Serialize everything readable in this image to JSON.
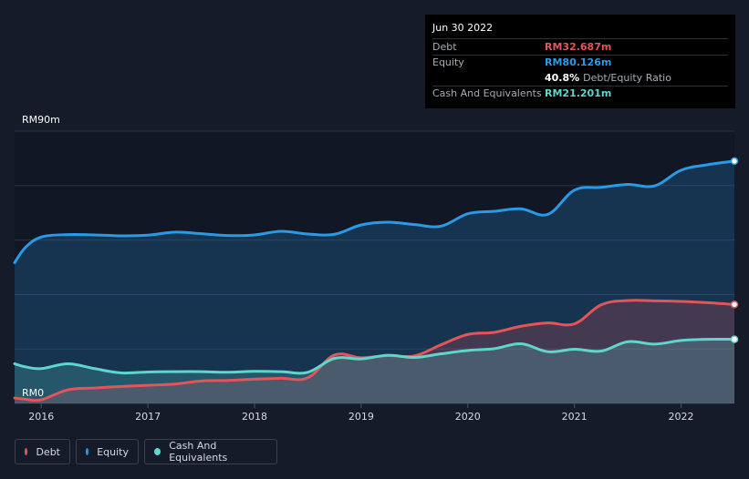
{
  "tooltip": {
    "date": "Jun 30 2022",
    "rows": [
      {
        "label": "Debt",
        "value": "RM32.687m",
        "color": "#e4545a"
      },
      {
        "label": "Equity",
        "value": "RM80.126m",
        "color": "#2a9ae6"
      },
      {
        "label": "",
        "value": "40.8%",
        "sub": "Debt/Equity Ratio",
        "color": "#ffffff"
      },
      {
        "label": "Cash And Equivalents",
        "value": "RM21.201m",
        "color": "#5fd6cc"
      }
    ]
  },
  "legend": [
    {
      "label": "Debt",
      "color": "#e4545a"
    },
    {
      "label": "Equity",
      "color": "#2a9ae6"
    },
    {
      "label": "Cash And Equivalents",
      "color": "#5fd6cc"
    }
  ],
  "chart_data": {
    "type": "area",
    "ylim": [
      0,
      90
    ],
    "y_tick_labels": [
      "RM90m",
      "RM0"
    ],
    "x_tick_labels": [
      "2016",
      "2017",
      "2018",
      "2019",
      "2020",
      "2021",
      "2022"
    ],
    "grid": true,
    "series": [
      {
        "name": "Equity",
        "color": "#2a9ae6",
        "x": [
          2015.75,
          2015.85,
          2016.0,
          2016.25,
          2016.5,
          2016.75,
          2017.0,
          2017.25,
          2017.5,
          2017.75,
          2018.0,
          2018.25,
          2018.5,
          2018.75,
          2019.0,
          2019.25,
          2019.5,
          2019.75,
          2020.0,
          2020.25,
          2020.5,
          2020.75,
          2021.0,
          2021.25,
          2021.5,
          2021.75,
          2022.0,
          2022.25,
          2022.5
        ],
        "values": [
          46.5,
          51.5,
          55.0,
          55.8,
          55.7,
          55.4,
          55.6,
          56.6,
          56.1,
          55.5,
          55.7,
          56.9,
          56.0,
          55.9,
          59.0,
          59.9,
          59.1,
          58.6,
          62.7,
          63.5,
          64.3,
          62.5,
          70.5,
          71.4,
          72.4,
          71.9,
          77.1,
          78.9,
          80.1
        ]
      },
      {
        "name": "Debt",
        "color": "#e4545a",
        "x": [
          2015.75,
          2015.85,
          2016.0,
          2016.25,
          2016.5,
          2016.75,
          2017.0,
          2017.25,
          2017.5,
          2017.75,
          2018.0,
          2018.25,
          2018.5,
          2018.75,
          2019.0,
          2019.25,
          2019.5,
          2019.75,
          2020.0,
          2020.25,
          2020.5,
          2020.75,
          2021.0,
          2021.25,
          2021.5,
          2021.75,
          2022.0,
          2022.25,
          2022.5
        ],
        "values": [
          1.8,
          1.4,
          1.2,
          4.5,
          5.1,
          5.6,
          6.0,
          6.4,
          7.4,
          7.6,
          8.0,
          8.3,
          8.5,
          16.0,
          15.1,
          15.8,
          15.7,
          19.4,
          22.8,
          23.5,
          25.5,
          26.6,
          26.3,
          32.6,
          34.0,
          33.9,
          33.7,
          33.3,
          32.7
        ]
      },
      {
        "name": "Cash And Equivalents",
        "color": "#5fd6cc",
        "x": [
          2015.75,
          2015.85,
          2016.0,
          2016.25,
          2016.5,
          2016.75,
          2017.0,
          2017.25,
          2017.5,
          2017.75,
          2018.0,
          2018.25,
          2018.5,
          2018.75,
          2019.0,
          2019.25,
          2019.5,
          2019.75,
          2020.0,
          2020.25,
          2020.5,
          2020.75,
          2021.0,
          2021.25,
          2021.5,
          2021.75,
          2022.0,
          2022.25,
          2022.5
        ],
        "values": [
          13.1,
          12.1,
          11.5,
          13.1,
          11.5,
          10.1,
          10.4,
          10.5,
          10.5,
          10.3,
          10.6,
          10.5,
          10.3,
          14.9,
          14.7,
          15.9,
          15.2,
          16.4,
          17.5,
          18.1,
          19.7,
          17.1,
          17.9,
          17.3,
          20.4,
          19.6,
          20.8,
          21.2,
          21.2
        ]
      }
    ]
  }
}
